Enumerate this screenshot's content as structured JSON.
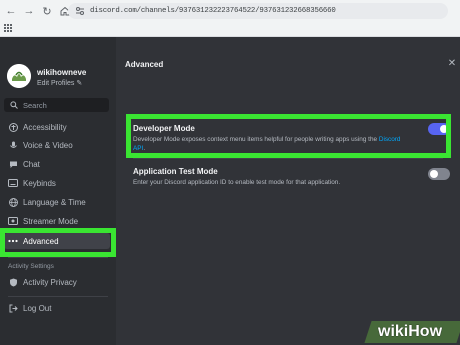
{
  "browser": {
    "url": "discord.com/channels/937631232223764522/937631232668356660"
  },
  "sidebar": {
    "username": "wikihowneve",
    "edit_profiles": "Edit Profiles",
    "search_placeholder": "Search",
    "items": [
      {
        "label": "Accessibility",
        "icon": "accessibility-icon"
      },
      {
        "label": "Voice & Video",
        "icon": "microphone-icon"
      },
      {
        "label": "Chat",
        "icon": "chat-icon"
      },
      {
        "label": "Keybinds",
        "icon": "keyboard-icon"
      },
      {
        "label": "Language & Time",
        "icon": "globe-icon"
      },
      {
        "label": "Streamer Mode",
        "icon": "streamer-icon"
      },
      {
        "label": "Advanced",
        "icon": "ellipsis-icon"
      }
    ],
    "activity_header": "Activity Settings",
    "activity_items": [
      {
        "label": "Activity Privacy",
        "icon": "shield-icon"
      }
    ],
    "logout": "Log Out"
  },
  "main": {
    "title": "Advanced",
    "settings": [
      {
        "title": "Developer Mode",
        "desc_prefix": "Developer Mode exposes context menu items helpful for people writing apps using the ",
        "link1": "Discord",
        "link2": "API",
        "desc_suffix": ".",
        "enabled": true
      },
      {
        "title": "Application Test Mode",
        "desc": "Enter your Discord application ID to enable test mode for that application.",
        "enabled": false
      }
    ]
  },
  "watermark": {
    "text": "wikiHow"
  },
  "colors": {
    "highlight": "#3ae532",
    "toggle_on": "#5865f2",
    "toggle_off": "#80848e",
    "link": "#00a8fc"
  }
}
